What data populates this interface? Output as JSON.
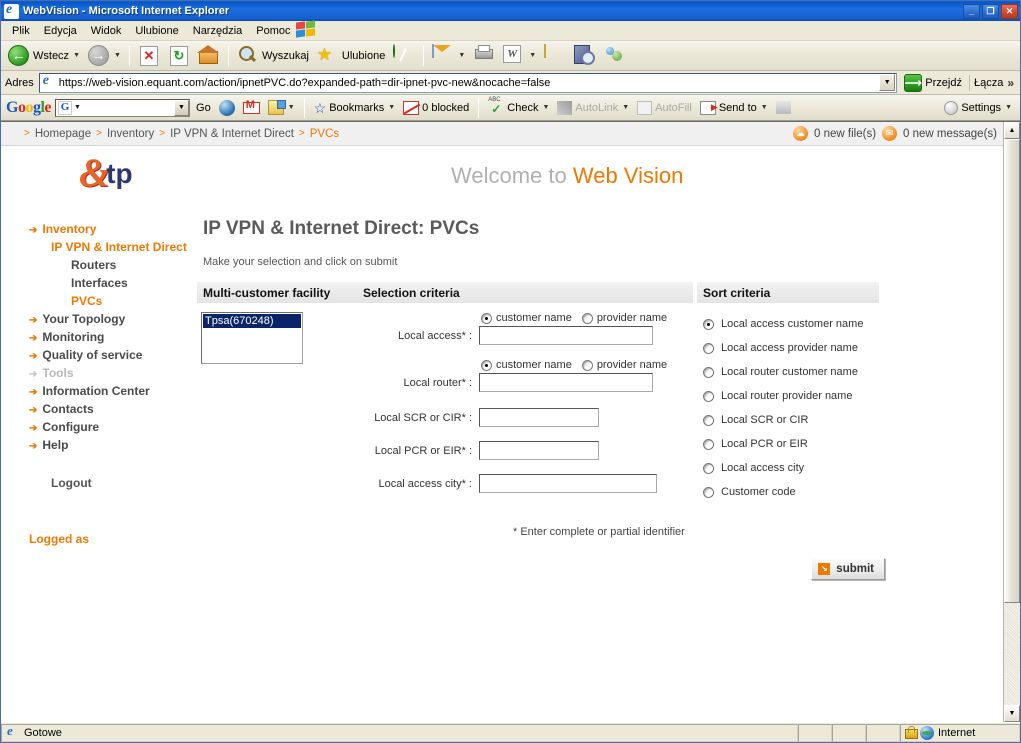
{
  "window": {
    "title": "WebVision - Microsoft Internet Explorer",
    "minimize": "_",
    "restore": "❐",
    "close": "✕"
  },
  "menu": {
    "items": [
      "Plik",
      "Edycja",
      "Widok",
      "Ulubione",
      "Narzędzia",
      "Pomoc"
    ]
  },
  "toolbar": {
    "back": "Wstecz",
    "forward": "",
    "stop": "✕",
    "refresh": "↻",
    "home": "",
    "search": "Wyszukaj",
    "favorites": "Ulubione",
    "history": "",
    "mail": "",
    "print": "",
    "word": "W",
    "notes": "",
    "research": "",
    "messenger": ""
  },
  "address": {
    "label": "Adres",
    "url": "https://web-vision.equant.com/action/ipnetPVC.do?expanded-path=dir-ipnet-pvc-new&nocache=false",
    "go": "Przejdź",
    "links": "Łącza",
    "links_chevron": "»",
    "dropdown_caret": "▼"
  },
  "google_toolbar": {
    "logo_letters": [
      {
        "ch": "G",
        "color": "b"
      },
      {
        "ch": "o",
        "color": "r"
      },
      {
        "ch": "o",
        "color": "y"
      },
      {
        "ch": "g",
        "color": "b"
      },
      {
        "ch": "l",
        "color": "g"
      },
      {
        "ch": "e",
        "color": "r"
      }
    ],
    "search_value": "",
    "search_badge": "G",
    "go_label": "Go",
    "bookmarks": "Bookmarks",
    "blocked": "0 blocked",
    "check": "Check",
    "autolink": "AutoLink",
    "autofill": "AutoFill",
    "send_to": "Send to",
    "settings": "Settings",
    "caret": "▾"
  },
  "breadcrumb": {
    "separator": ">",
    "items": [
      {
        "label": "Homepage",
        "active": false
      },
      {
        "label": "Inventory",
        "active": false
      },
      {
        "label": "IP VPN & Internet Direct",
        "active": false
      },
      {
        "label": "PVCs",
        "active": true
      }
    ],
    "files_notice": "0 new file(s)",
    "messages_notice": "0 new message(s)"
  },
  "brand": {
    "logo_mark": "&",
    "logo_text": "tp",
    "welcome_prefix": "Welcome to ",
    "welcome_highlight": "Web Vision"
  },
  "sidebar": {
    "items": [
      {
        "label": "Inventory",
        "style": "orange",
        "level": 0,
        "arrow": true
      },
      {
        "label": "IP VPN & Internet Direct",
        "style": "orange",
        "level": 1,
        "arrow": false
      },
      {
        "label": "Routers",
        "style": "dark",
        "level": 2,
        "arrow": false
      },
      {
        "label": "Interfaces",
        "style": "dark",
        "level": 2,
        "arrow": false
      },
      {
        "label": "PVCs",
        "style": "orange",
        "level": 2,
        "arrow": false
      },
      {
        "label": "Your Topology",
        "style": "dark",
        "level": 0,
        "arrow": true
      },
      {
        "label": "Monitoring",
        "style": "dark",
        "level": 0,
        "arrow": true
      },
      {
        "label": "Quality of service",
        "style": "dark",
        "level": 0,
        "arrow": true
      },
      {
        "label": "Tools",
        "style": "gray",
        "level": 0,
        "arrow": true
      },
      {
        "label": "Information Center",
        "style": "dark",
        "level": 0,
        "arrow": true
      },
      {
        "label": "Contacts",
        "style": "dark",
        "level": 0,
        "arrow": true
      },
      {
        "label": "Configure",
        "style": "dark",
        "level": 0,
        "arrow": true
      },
      {
        "label": "Help",
        "style": "dark",
        "level": 0,
        "arrow": true
      }
    ],
    "logout": "Logout",
    "logged_as": "Logged as",
    "arrow_glyph": "➔"
  },
  "main": {
    "page_title": "IP VPN & Internet Direct: PVCs",
    "instruction": "Make your selection and click on submit",
    "headers": {
      "multi_customer_facility": "Multi-customer facility",
      "selection_criteria": "Selection criteria",
      "sort_criteria": "Sort criteria"
    },
    "facility_list": {
      "options": [
        "Tpsa(670248)"
      ],
      "selected": "Tpsa(670248)"
    },
    "fields": [
      {
        "label": "Local access* :",
        "value": "",
        "width": "w174",
        "radios": [
          {
            "label": "customer name",
            "checked": true
          },
          {
            "label": "provider name",
            "checked": false
          }
        ]
      },
      {
        "label": "Local router* :",
        "value": "",
        "width": "w174",
        "radios": [
          {
            "label": "customer name",
            "checked": true
          },
          {
            "label": "provider name",
            "checked": false
          }
        ]
      },
      {
        "label": "Local SCR or CIR* :",
        "value": "",
        "width": "w120",
        "radios": []
      },
      {
        "label": "Local PCR or EIR* :",
        "value": "",
        "width": "w120",
        "radios": []
      },
      {
        "label": "Local access city* :",
        "value": "",
        "width": "w178",
        "radios": []
      }
    ],
    "sort_options": [
      {
        "label": "Local  access customer name",
        "checked": true
      },
      {
        "label": "Local  access provider name",
        "checked": false
      },
      {
        "label": "Local router customer name",
        "checked": false
      },
      {
        "label": "Local router provider name",
        "checked": false
      },
      {
        "label": "Local SCR or CIR",
        "checked": false
      },
      {
        "label": "Local PCR or EIR",
        "checked": false
      },
      {
        "label": "Local access city",
        "checked": false
      },
      {
        "label": "Customer code",
        "checked": false
      }
    ],
    "footnote": "* Enter complete or partial identifier",
    "submit_label": "submit",
    "submit_icon": "↘"
  },
  "statusbar": {
    "status": "Gotowe",
    "zone": "Internet"
  },
  "colors": {
    "accent_orange": "#f07800",
    "brand_navy": "#2b3a6b",
    "title_blue": "#1b6fde",
    "select_blue": "#0a246a"
  }
}
